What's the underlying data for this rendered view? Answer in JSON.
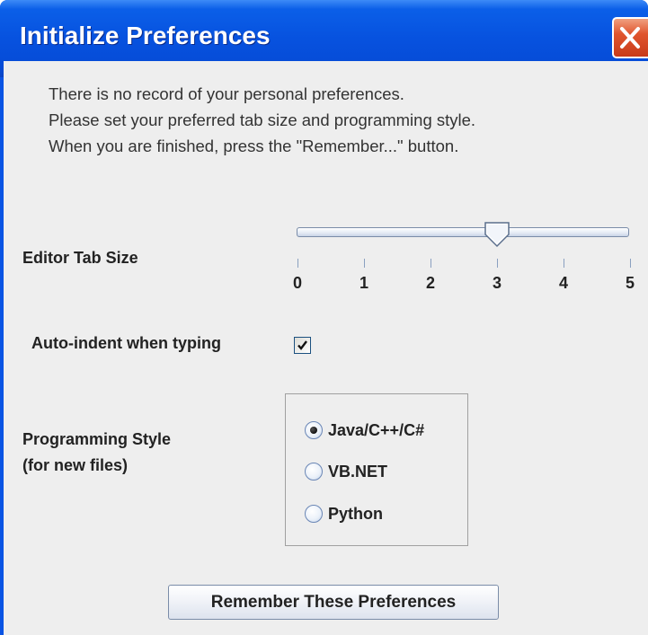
{
  "window": {
    "title": "Initialize Preferences",
    "close_icon": "close-icon",
    "colors": {
      "titlebar": "#0752df",
      "close_button": "#e0552e",
      "body": "#eeeeee"
    }
  },
  "intro": {
    "lines": [
      "There is no record of your personal preferences.",
      "Please set your preferred tab size and programming style.",
      "When you are finished, press the \"Remember...\" button."
    ]
  },
  "tab_size": {
    "label": "Editor Tab Size",
    "min": 0,
    "max": 5,
    "value": 3,
    "ticks": [
      "0",
      "1",
      "2",
      "3",
      "4",
      "5"
    ]
  },
  "auto_indent": {
    "label": "Auto-indent when typing",
    "checked": true
  },
  "programming_style": {
    "label_line1": "Programming Style",
    "label_line2": " (for new files)",
    "options": [
      "Java/C++/C#",
      "VB.NET",
      "Python"
    ],
    "selected": "Java/C++/C#"
  },
  "buttons": {
    "remember_label": "Remember These Preferences"
  }
}
